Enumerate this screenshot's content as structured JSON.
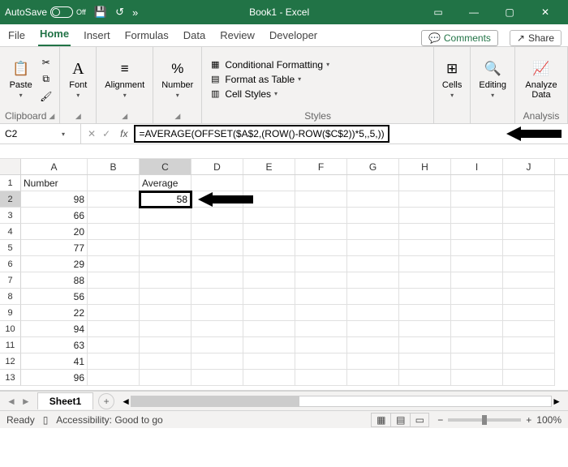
{
  "titlebar": {
    "autosave": "AutoSave",
    "state": "Off",
    "title": "Book1 - Excel"
  },
  "tabs": {
    "items": [
      "File",
      "Home",
      "Insert",
      "Formulas",
      "Data",
      "Review",
      "Developer"
    ],
    "active": 1,
    "comments": "Comments",
    "share": "Share"
  },
  "ribbon": {
    "clipboard": {
      "paste": "Paste",
      "label": "Clipboard"
    },
    "font": {
      "label": "Font"
    },
    "alignment": {
      "label": "Alignment"
    },
    "number": {
      "btn": "%",
      "label": "Number"
    },
    "styles": {
      "cf": "Conditional Formatting",
      "fat": "Format as Table",
      "cs": "Cell Styles",
      "label": "Styles"
    },
    "cells": {
      "label": "Cells"
    },
    "editing": {
      "label": "Editing"
    },
    "analyze": {
      "label": "Analyze Data",
      "group": "Analysis"
    }
  },
  "namebox": {
    "ref": "C2"
  },
  "formula": {
    "text": "=AVERAGE(OFFSET($A$2,(ROW()-ROW($C$2))*5,,5,))"
  },
  "cols": [
    "A",
    "B",
    "C",
    "D",
    "E",
    "F",
    "G",
    "H",
    "I",
    "J"
  ],
  "rows": [
    "1",
    "2",
    "3",
    "4",
    "5",
    "6",
    "7",
    "8",
    "9",
    "10",
    "11",
    "12",
    "13"
  ],
  "headers": {
    "a": "Number",
    "c": "Average"
  },
  "colA": [
    "98",
    "66",
    "20",
    "77",
    "29",
    "88",
    "56",
    "22",
    "94",
    "63",
    "41",
    "96"
  ],
  "selected_value": "58",
  "sheets": {
    "name": "Sheet1"
  },
  "status": {
    "ready": "Ready",
    "access": "Accessibility: Good to go",
    "zoom": "100%"
  },
  "chart_data": {
    "type": "table",
    "title": "Book1 - Excel",
    "note": "C2 formula computes average of 5-row offset blocks in column A",
    "columns": [
      "Number",
      "Average"
    ],
    "rows": [
      [
        98,
        58
      ],
      [
        66,
        null
      ],
      [
        20,
        null
      ],
      [
        77,
        null
      ],
      [
        29,
        null
      ],
      [
        88,
        null
      ],
      [
        56,
        null
      ],
      [
        22,
        null
      ],
      [
        94,
        null
      ],
      [
        63,
        null
      ],
      [
        41,
        null
      ],
      [
        96,
        null
      ]
    ]
  }
}
